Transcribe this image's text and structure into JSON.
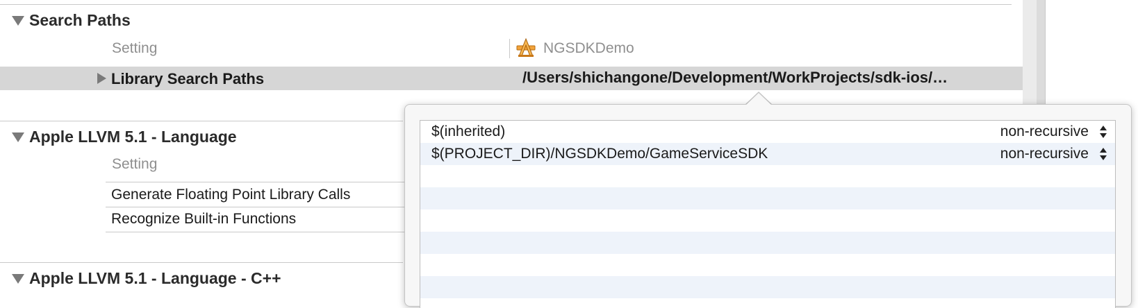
{
  "sections": {
    "search_paths": {
      "title": "Search Paths",
      "col_setting": "Setting",
      "col_target": "NGSDKDemo",
      "rows": [
        {
          "label": "Library Search Paths",
          "value": "/Users/shichangone/Development/WorkProjects/sdk-ios/…"
        }
      ]
    },
    "llvm_language": {
      "title": "Apple LLVM 5.1 - Language",
      "col_setting": "Setting",
      "rows": [
        {
          "label": "Generate Floating Point Library Calls"
        },
        {
          "label": "Recognize Built-in Functions"
        }
      ]
    },
    "llvm_language_cpp": {
      "title": "Apple LLVM 5.1 - Language - C++"
    }
  },
  "popover": {
    "rows": [
      {
        "path": "$(inherited)",
        "recursion": "non-recursive"
      },
      {
        "path": "$(PROJECT_DIR)/NGSDKDemo/GameServiceSDK",
        "recursion": "non-recursive"
      }
    ]
  },
  "icons": {
    "disclosure_open": "disclosure-triangle-down-icon",
    "disclosure_closed": "disclosure-triangle-right-icon",
    "app_target": "xcode-app-target-icon",
    "stepper": "up-down-stepper-icon"
  },
  "colors": {
    "selected_row": "#d6d6d6",
    "alt_row": "#eef3fa",
    "header_text": "#8f8f8f"
  }
}
